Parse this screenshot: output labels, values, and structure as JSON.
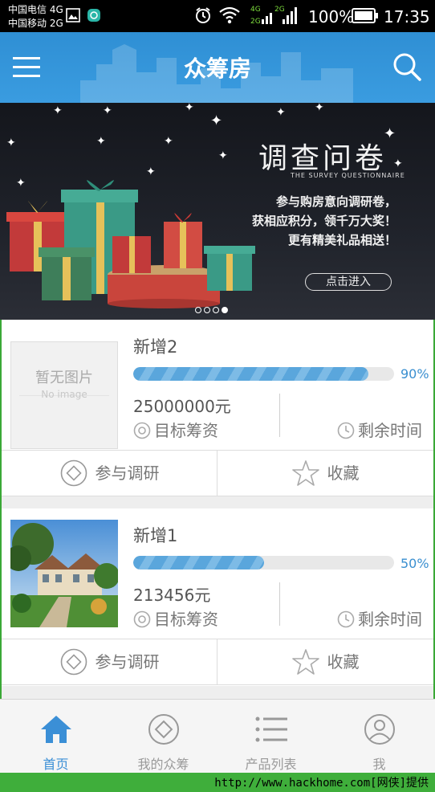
{
  "status_bar": {
    "carrier_1": "中国电信 4G",
    "carrier_2": "中国移动 2G",
    "battery": "100%",
    "time": "17:35"
  },
  "app_bar": {
    "title": "众筹房",
    "menu_icon": "menu-icon",
    "search_icon": "search-icon"
  },
  "banner": {
    "title": "调查问卷",
    "subtitle": "THE SURVEY QUESTIONNAIRE",
    "lines": [
      "参与购房意向调研卷，",
      "获相应积分，领千万大奖！",
      "更有精美礼品相送！"
    ],
    "button": "点击进入",
    "slide_count": 4,
    "active_slide": 4
  },
  "projects": [
    {
      "name": "新增2",
      "image_placeholder": "暂无图片",
      "image_placeholder_en": "No image",
      "progress": 0.9,
      "progress_label": "90%",
      "amount": "25000000元",
      "target_label": "目标筹资",
      "time_label": "剩余时间",
      "participate": "参与调研",
      "favorite": "收藏"
    },
    {
      "name": "新增1",
      "progress": 0.5,
      "progress_label": "50%",
      "amount": "213456元",
      "target_label": "目标筹资",
      "time_label": "剩余时间",
      "participate": "参与调研",
      "favorite": "收藏"
    }
  ],
  "tabs": [
    {
      "label": "首页",
      "icon": "home-icon",
      "active": true
    },
    {
      "label": "我的众筹",
      "icon": "diamond-circle-icon",
      "active": false
    },
    {
      "label": "产品列表",
      "icon": "list-icon",
      "active": false
    },
    {
      "label": "我",
      "icon": "user-icon",
      "active": false
    }
  ],
  "colors": {
    "accent": "#3b8fd6",
    "app_bar": "#3a9ce0",
    "progress": "#5aa6dc"
  },
  "watermark": "http://www.hackhome.com[网侠]提供"
}
